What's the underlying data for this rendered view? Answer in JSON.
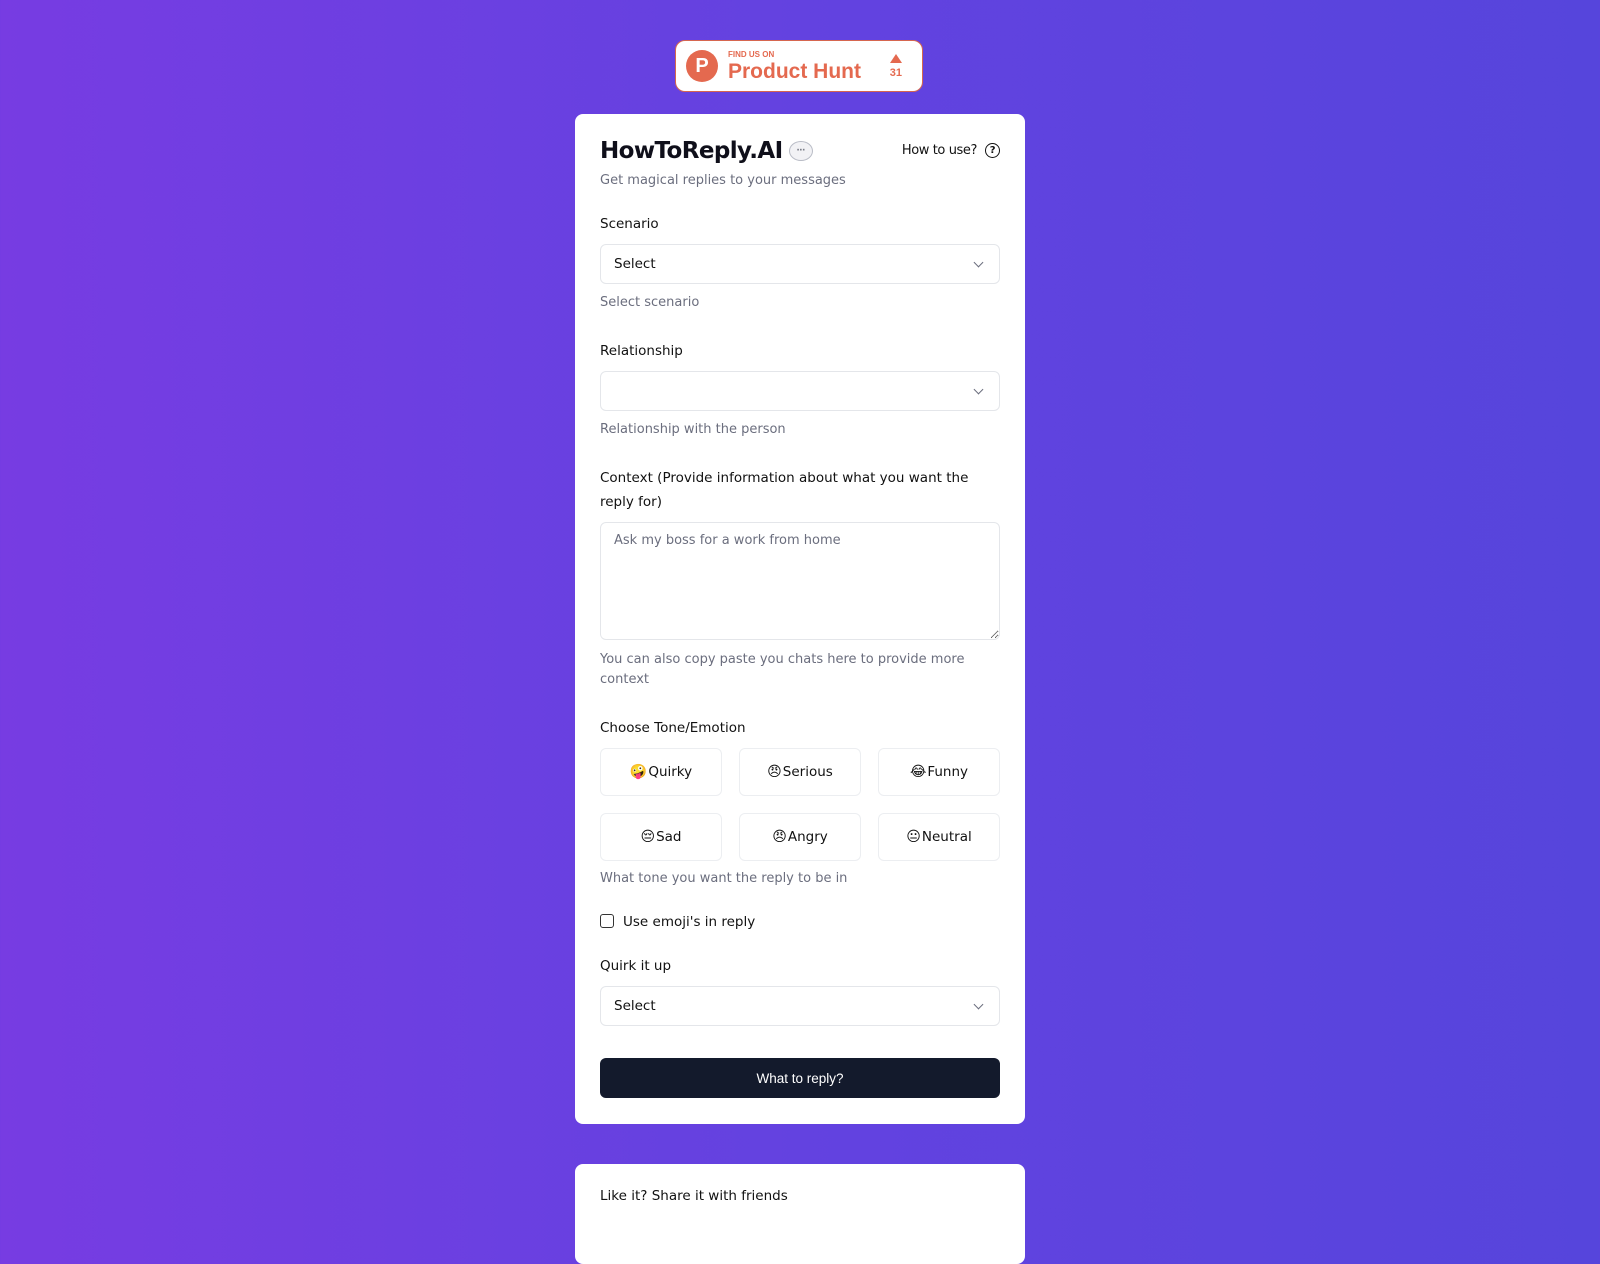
{
  "product_hunt": {
    "find_text": "FIND US ON",
    "name": "Product Hunt",
    "logo_letter": "P",
    "upvotes": "31",
    "color": "#e4694f"
  },
  "header": {
    "title": "HowToReply.AI",
    "title_icon": "speech-bubble-icon",
    "subtitle": "Get magical replies to your messages",
    "help_label": "How to use?",
    "help_icon_glyph": "?"
  },
  "form": {
    "scenario": {
      "label": "Scenario",
      "value": "Select",
      "hint": "Select scenario"
    },
    "relationship": {
      "label": "Relationship",
      "value": "",
      "hint": "Relationship with the person"
    },
    "context": {
      "label": "Context (Provide information about what you want the reply for)",
      "placeholder": "Ask my boss for a work from home",
      "value": "",
      "hint": "You can also copy paste you chats here to provide more context"
    },
    "tone": {
      "label": "Choose Tone/Emotion",
      "options": [
        {
          "emoji": "🤪",
          "label": "Quirky"
        },
        {
          "emoji": "😠",
          "label": "Serious"
        },
        {
          "emoji": "😂",
          "label": "Funny"
        },
        {
          "emoji": "😔",
          "label": "Sad"
        },
        {
          "emoji": "😠",
          "label": "Angry"
        },
        {
          "emoji": "😐",
          "label": "Neutral"
        }
      ],
      "hint": "What tone you want the reply to be in"
    },
    "use_emoji": {
      "label": "Use emoji's in reply",
      "checked": false
    },
    "quirk": {
      "label": "Quirk it up",
      "value": "Select"
    },
    "submit_label": "What to reply?",
    "submit_color": "#131a2c"
  },
  "share": {
    "label": "Like it? Share it with friends"
  }
}
